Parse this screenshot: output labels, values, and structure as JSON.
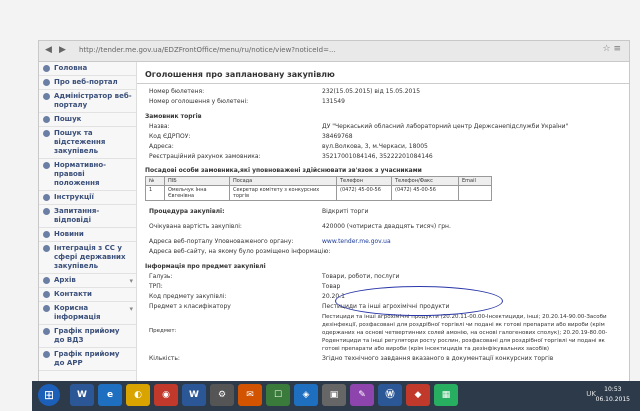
{
  "browser": {
    "url": "http://tender.me.gov.ua/EDZFrontOffice/menu/ru/notice/view?noticeId=...",
    "back_icon": "back-arrow-icon",
    "forward_icon": "forward-arrow-icon"
  },
  "sidebar": {
    "items": [
      {
        "label": "Головна"
      },
      {
        "label": "Про веб-портал"
      },
      {
        "label": "Адміністратор веб-порталу"
      },
      {
        "label": "Пошук"
      },
      {
        "label": "Пошук та відстеження закупівель"
      },
      {
        "label": "Нормативно-правові положення"
      },
      {
        "label": "Інструкції"
      },
      {
        "label": "Запитання-відповіді"
      },
      {
        "label": "Новини"
      },
      {
        "label": "Інтеграція з СС у сфері державних закупівель"
      },
      {
        "label": "Архів"
      },
      {
        "label": "Контакти"
      },
      {
        "label": "Корисна інформація"
      },
      {
        "label": "Графік прийому до ВДЗ"
      },
      {
        "label": "Графік прийому до АРР"
      }
    ]
  },
  "main": {
    "title": "Оголошення про заплановану закупівлю",
    "bulletin_no_label": "Номер бюлетеня:",
    "bulletin_no_value": "232(15.05.2015) від 15.05.2015",
    "notice_no_label": "Номер оголошення у бюлетені:",
    "notice_no_value": "131549",
    "customer_section": "Замовник торгів",
    "name_label": "Назва:",
    "name_value": "ДУ \"Черкаський обласний лабораторний центр Держсанепідслужби України\"",
    "edrpou_label": "Код ЄДРПОУ:",
    "edrpou_value": "38469768",
    "address_label": "Адреса:",
    "address_value": "вул.Волкова, 3, м.Черкаси, 18005",
    "account_label": "Реєстраційний рахунок замовника:",
    "account_value": "35217001084146, 35222201084146",
    "officials_section": "Посадові особи замовника,які уповноважені здійснювати зв'язок з учасниками",
    "table_headers": [
      "№",
      "ПІБ",
      "Посада",
      "Телефон",
      "Телефон/Факс",
      "Email"
    ],
    "table_rows": [
      [
        "1",
        "Омельчук Інна Євгенівна",
        "Секретар комітету з конкурсних торгів",
        "(0472) 45-00-56",
        "(0472) 45-00-56",
        ""
      ]
    ],
    "procedure_label": "Процедура закупівлі:",
    "procedure_value": "Відкриті торги",
    "cost_label": "Очікувана вартість закупівлі:",
    "cost_value": "420000 (чотириста двадцять тисяч) грн.",
    "portal_label": "Адреса веб-порталу Уповноваженого органу:",
    "portal_value": "www.tender.me.gov.ua",
    "site_label": "Адреса веб-сайту, на якому було розміщено інформацію:",
    "site_value": "",
    "subject_section": "Інформація про предмет закупівлі",
    "branch_label": "Галузь:",
    "branch_value": "Товари, роботи, послуги",
    "trp_label": "ТРП:",
    "trp_value": "Товар",
    "code_label": "Код предмету закупівлі:",
    "code_value": "20.20.1",
    "classifier_label": "Предмет з класифікатору",
    "classifier_value": "Пестициди та інші агрохімічні продукти",
    "subject_label": "Предмет:",
    "subject_lines": [
      "Пестициди та інші агрохімічні продукти (20.20.11-00.00-Інсектициди, інші; 20.20.14-90.00-Засоби",
      "дезінфекції, розфасовані для роздрібної торгівлі чи подані як готові препарати або вироби (крім",
      "одержаних на основі четвертинних солей амонію, на основі галогенових сполук); 20.20.19-80.00-",
      "Родентициди та інші регулятори росту рослин, розфасовані для роздрібної торгівлі чи подані як",
      "готові препарати або вироби (крім інсектицидів та дезінфікувальних засобів)"
    ],
    "quantity_label": "Кількість:",
    "quantity_value": "Згідно технічного завдання вказаного в документації конкурсних торгів"
  },
  "taskbar": {
    "apps": [
      "W",
      "e",
      "◐",
      "◉",
      "W",
      "⚙",
      "✉",
      "☐",
      "◈",
      "▣",
      "✎",
      "Ⓦ",
      "◆",
      "▦"
    ],
    "lang": "UK",
    "time": "10:53",
    "date": "06.10.2015"
  },
  "colors": {
    "accent": "#3a4f7a",
    "oval": "#2a37a8",
    "taskbar": "#2c3a4a"
  }
}
